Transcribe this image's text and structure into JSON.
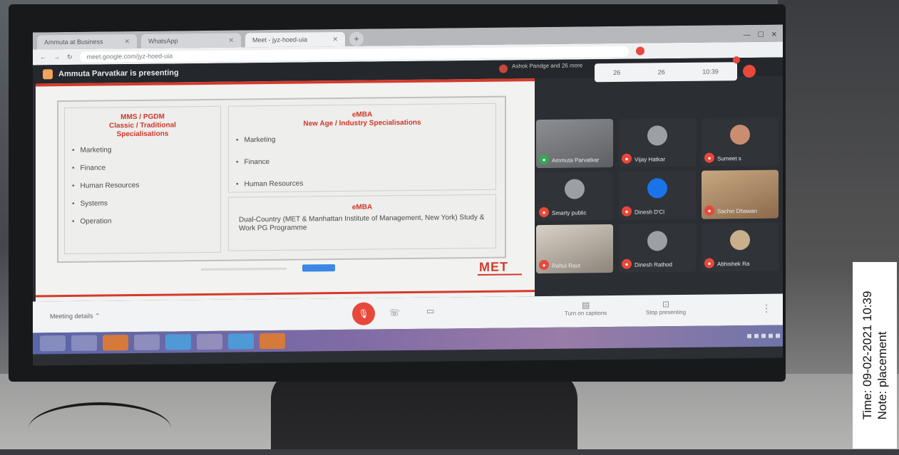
{
  "browser": {
    "tabs": [
      {
        "label": "Ammuta at Business"
      },
      {
        "label": "WhatsApp"
      },
      {
        "label": "Meet - jyz-hoed-uia"
      }
    ],
    "url": "meet.google.com/jyz-hoed-uia"
  },
  "meet": {
    "presenter_label": "Ammuta Parvatkar is presenting",
    "others_label": "Ashok Pandge and 26 more",
    "stats": [
      "26",
      "26",
      "10:39"
    ],
    "meeting_details": "Meeting details",
    "actions": [
      {
        "label": "Turn on captions"
      },
      {
        "label": "Stop presenting"
      }
    ],
    "participants": [
      {
        "name": "Ammuta Parvatkar",
        "video": true
      },
      {
        "name": "Vijay Hatkar",
        "video": false
      },
      {
        "name": "Sumeet s",
        "video": false
      },
      {
        "name": "Smarty public",
        "video": false
      },
      {
        "name": "Dinesh D'Cl",
        "video": false
      },
      {
        "name": "Sachin Dhawan",
        "video": true
      },
      {
        "name": "Rahul Raut",
        "video": true
      },
      {
        "name": "Dinesh Rathod",
        "video": false
      },
      {
        "name": "Abhishek Ra",
        "video": false
      }
    ]
  },
  "slide": {
    "left_heading": "MMS / PGDM\nClassic / Traditional\nSpecialisations",
    "left_items": [
      "Marketing",
      "Finance",
      "Human Resources",
      "Systems",
      "Operation"
    ],
    "right_heading": "eMBA\nNew Age / Industry Specialisations",
    "right_items": [
      "Marketing",
      "Finance",
      "Human Resources"
    ],
    "bottom_heading": "eMBA",
    "bottom_text": "Dual-Country (MET & Manhattan Institute of Management, New York) Study & Work PG Programme",
    "logo": "MET"
  },
  "overlay": {
    "time": "Time: 09-02-2021 10:39",
    "note": "Note: placement"
  },
  "colors": {
    "accent_red": "#d33a2c",
    "meet_dark": "#24272b",
    "mic_red": "#e8483b",
    "button_blue": "#3b87e4"
  }
}
